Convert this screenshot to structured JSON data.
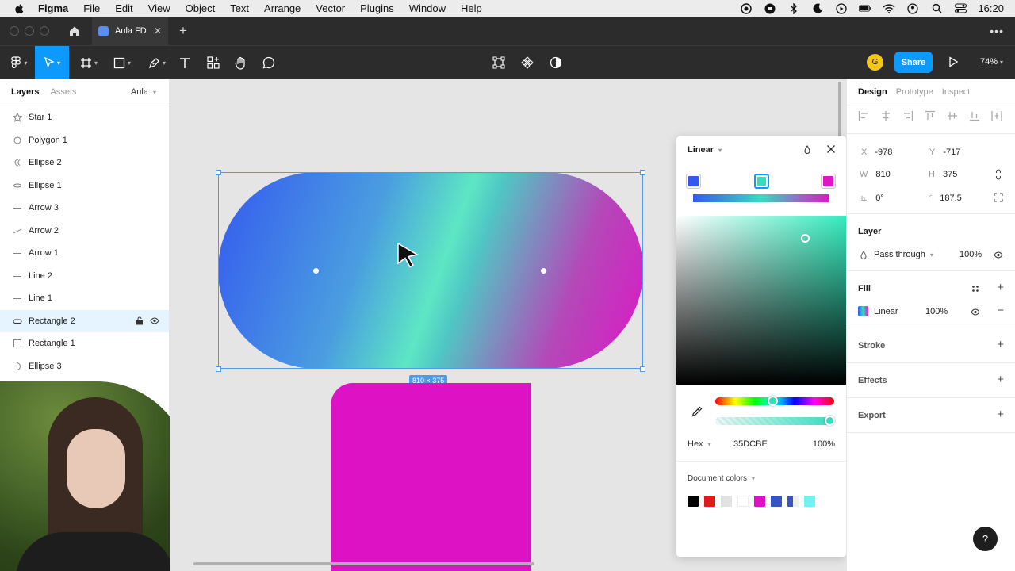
{
  "menubar": {
    "app_name": "Figma",
    "items": [
      "File",
      "Edit",
      "View",
      "Object",
      "Text",
      "Arrange",
      "Vector",
      "Plugins",
      "Window",
      "Help"
    ],
    "clock": "16:20"
  },
  "tabs": {
    "file_tab": "Aula FD"
  },
  "toolbar": {
    "share_label": "Share",
    "zoom": "74%",
    "avatar_initial": "G"
  },
  "left_panel": {
    "tab_layers": "Layers",
    "tab_assets": "Assets",
    "page_name": "Aula",
    "layers": [
      {
        "name": "Star 1",
        "icon": "star-icon"
      },
      {
        "name": "Polygon 1",
        "icon": "polygon-icon"
      },
      {
        "name": "Ellipse 2",
        "icon": "ellipse-icon"
      },
      {
        "name": "Ellipse 1",
        "icon": "ellipse-icon"
      },
      {
        "name": "Arrow 3",
        "icon": "arrow-icon"
      },
      {
        "name": "Arrow 2",
        "icon": "arrow-icon"
      },
      {
        "name": "Arrow 1",
        "icon": "arrow-icon"
      },
      {
        "name": "Line 2",
        "icon": "line-icon"
      },
      {
        "name": "Line 1",
        "icon": "line-icon"
      },
      {
        "name": "Rectangle 2",
        "icon": "rounded-rect-icon",
        "selected": true
      },
      {
        "name": "Rectangle 1",
        "icon": "rect-icon"
      },
      {
        "name": "Ellipse 3",
        "icon": "ellipse-icon"
      }
    ]
  },
  "canvas": {
    "dimension_badge": "810 × 375",
    "gradient_colors": [
      "#3559f0",
      "#35dcbe",
      "#dd17c6"
    ],
    "rect_color": "#dd12c4"
  },
  "picker": {
    "fill_type": "Linear",
    "stop_colors": [
      "#3559f0",
      "#35dcbe",
      "#dd17c6"
    ],
    "color_mode": "Hex",
    "hex_value": "35DCBE",
    "opacity": "100%",
    "document_colors_label": "Document colors",
    "document_colors": [
      "#000000",
      "#e01919",
      "#e2e2e2",
      "#ffffff",
      "#dd12c4",
      "#3654c2",
      "#3654c2",
      "#6ef2f2"
    ]
  },
  "right_panel": {
    "tab_design": "Design",
    "tab_prototype": "Prototype",
    "tab_inspect": "Inspect",
    "x_label": "X",
    "x_value": "-978",
    "y_label": "Y",
    "y_value": "-717",
    "w_label": "W",
    "w_value": "810",
    "h_label": "H",
    "h_value": "375",
    "rotation": "0°",
    "corner_radius": "187.5",
    "layer_title": "Layer",
    "blend_mode": "Pass through",
    "layer_opacity": "100%",
    "fill_title": "Fill",
    "fill_type": "Linear",
    "fill_opacity": "100%",
    "stroke_title": "Stroke",
    "effects_title": "Effects",
    "export_title": "Export"
  },
  "help": "?"
}
